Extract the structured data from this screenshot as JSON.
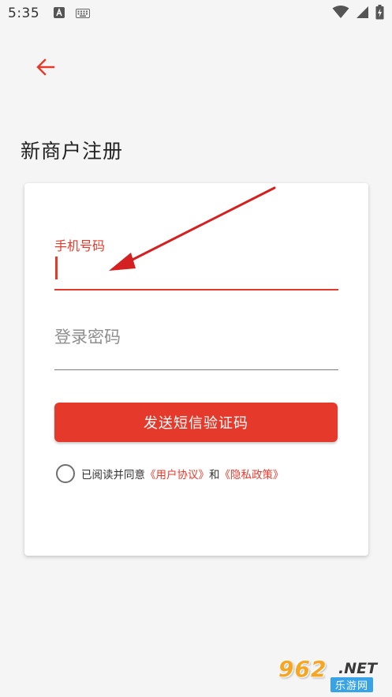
{
  "status_bar": {
    "time": "5:35",
    "icons_left": [
      "a-letter-icon",
      "keyboard-icon"
    ],
    "icons_right": [
      "wifi-icon",
      "signal-icon",
      "battery-charging-icon"
    ]
  },
  "header": {
    "back_icon": "arrow-left-icon",
    "title": "新商户注册"
  },
  "form": {
    "phone_label": "手机号码",
    "phone_value": "",
    "password_placeholder": "登录密码",
    "password_value": "",
    "send_code_label": "发送短信验证码",
    "agreement": {
      "checked": false,
      "prefix": "已阅读并同意",
      "user_agreement": "《用户协议》",
      "conjunction": "和",
      "privacy_policy": "《隐私政策》"
    }
  },
  "watermark": {
    "main": "962",
    "suffix": ".NET",
    "sub": "乐游网"
  },
  "colors": {
    "accent": "#e53a2b",
    "background": "#f5f5f5",
    "card": "#ffffff"
  }
}
